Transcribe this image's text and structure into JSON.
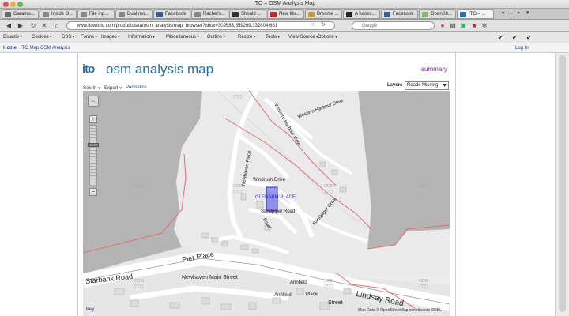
{
  "window": {
    "title": "ITO – OSM Analysis Map"
  },
  "tabs": [
    {
      "label": "Garamo...",
      "icon": "wikipedia-icon",
      "color": "#666666"
    },
    {
      "label": "Inside O...",
      "icon": "page-icon",
      "color": "#888888"
    },
    {
      "label": "File inp...",
      "icon": "page-icon",
      "color": "#888888"
    },
    {
      "label": "Dual mo...",
      "icon": "page-icon",
      "color": "#888888"
    },
    {
      "label": "Facebook",
      "icon": "facebook-icon",
      "color": "#3b5998"
    },
    {
      "label": "Rachel's...",
      "icon": "page-icon",
      "color": "#888888"
    },
    {
      "label": "Should ...",
      "icon": "page-icon",
      "color": "#333333"
    },
    {
      "label": "New libr...",
      "icon": "page-icon",
      "color": "#c0282d"
    },
    {
      "label": "Broome ...",
      "icon": "page-icon",
      "color": "#c49a3a"
    },
    {
      "label": "A books...",
      "icon": "page-icon",
      "color": "#222222"
    },
    {
      "label": "Facebook",
      "icon": "facebook-icon",
      "color": "#3b5998"
    },
    {
      "label": "OpenStr...",
      "icon": "osm-icon",
      "color": "#7ebc6f"
    },
    {
      "label": "ITO – ...",
      "icon": "ito-icon",
      "color": "#2a6ea8",
      "active": true
    }
  ],
  "toolbar": {
    "url": "www.itoworld.com/product/data/osm_analysis/map_browser?bbox=309583,659269,332804,681",
    "search_placeholder": "Google"
  },
  "devtools": [
    "Disable",
    "Cookies",
    "CSS",
    "Forms",
    "Images",
    "Information",
    "Miscellaneous",
    "Outline",
    "Resize",
    "Tools",
    "View Source",
    "Options"
  ],
  "sitenav": {
    "home": "Home",
    "ito_map": "ITO Map",
    "osm_analysis": "OSM Analysis",
    "login": "Log In"
  },
  "header": {
    "logo": "ito",
    "title": "osm analysis map",
    "summary": "summary"
  },
  "controls": {
    "see_in": "See In",
    "export": "Export",
    "permalink": "Permalink",
    "layers_label": "Layers",
    "layer_selected": "Roads Missing"
  },
  "map": {
    "streets": [
      "Pier Place",
      "Starbank Road",
      "Lindsay Road",
      "Newhaven Main Street",
      "Western Harbour Drive",
      "Windrush Drive",
      "Sandpiper Drive",
      "Annfield",
      "Street",
      "Western Harbour View",
      "Newhaven Place",
      "Sandpiper Road",
      "Annfield",
      "Place",
      "Road"
    ],
    "highlight_label": "GLENARM PLACE",
    "watermarks": [
      "ITO",
      "ITO",
      "ITO",
      "ITO",
      "ITO",
      "ITO",
      "ITO",
      "ITO",
      "ITO",
      "ITO"
    ],
    "odbl_labels": [
      "ODBL",
      "ODBL",
      "ODBL",
      "ODBL",
      "ODBL",
      "ODBL",
      "ODBL"
    ],
    "attribution": "Map Data © OpenStreetMap contributors ODBL",
    "key": "Key",
    "colors": {
      "missing_road": "#e05050",
      "highlight": "#5a5ae8",
      "land": "#eeeeee",
      "water": "#b3b3b3",
      "road": "#ffffff"
    }
  }
}
